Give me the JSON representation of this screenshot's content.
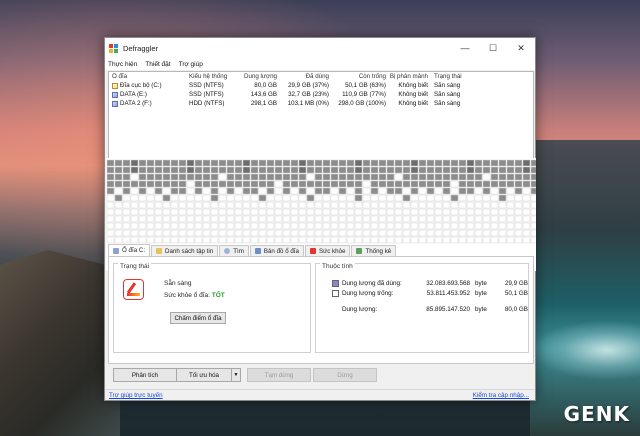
{
  "window": {
    "title": "Defraggler"
  },
  "menu": [
    "Thực hiện",
    "Thiết đặt",
    "Trợ giúp"
  ],
  "columns": [
    "Ổ đĩa",
    "Kiểu hệ thống",
    "Dung lượng",
    "Đã dùng",
    "Còn trống",
    "Bị phân mảnh",
    "Trạng thái"
  ],
  "drives": [
    {
      "name": "Đĩa cục bộ (C:)",
      "fs": "SSD (NTFS)",
      "capacity": "80,0 GB",
      "used": "29,9 GB (37%)",
      "free": "50,1 GB (63%)",
      "frag": "Không biết",
      "status": "Sẵn sàng"
    },
    {
      "name": "DATA (E:)",
      "fs": "SSD (NTFS)",
      "capacity": "143,6 GB",
      "used": "32,7 GB (23%)",
      "free": "110,9 GB (77%)",
      "frag": "Không biết",
      "status": "Sẵn sàng"
    },
    {
      "name": "DATA 2 (F:)",
      "fs": "HDD (NTFS)",
      "capacity": "298,1 GB",
      "used": "103,1 MB (0%)",
      "free": "298,0 GB (100%)",
      "frag": "Không biết",
      "status": "Sẵn sàng"
    }
  ],
  "tabs": [
    "Ổ đĩa C:",
    "Danh sách tập tin",
    "Tìm",
    "Bản đồ ổ đĩa",
    "Sức khỏe",
    "Thống kê"
  ],
  "status_panel": {
    "title": "Trạng thái",
    "ready": "Sẵn sàng",
    "health_label": "Sức khỏe ổ đĩa:",
    "health_value": "TỐT",
    "benchmark_button": "Chấm điểm ổ đĩa"
  },
  "properties": {
    "title": "Thuộc tính",
    "used_label": "Dung lượng đã dùng:",
    "used_bytes": "32.083.693.568",
    "used_unit": "byte",
    "used_size": "29,9 GB",
    "free_label": "Dung lượng trống:",
    "free_bytes": "53.811.453.952",
    "free_unit": "byte",
    "free_size": "50,1 GB",
    "total_label": "Dung lượng:",
    "total_bytes": "85.895.147.520",
    "total_unit": "byte",
    "total_size": "80,0 GB",
    "used_color": "#8a86d6",
    "free_color": "#ffffff"
  },
  "actions": {
    "analyze": "Phân tích",
    "optimize": "Tối ưu hóa",
    "pause": "Tạm dừng",
    "stop": "Dừng"
  },
  "footer": {
    "help_link": "Trợ giúp trực tuyến",
    "update_link": "Kiểm tra cập nhập..."
  },
  "watermark": "GENK",
  "colors": {
    "block_used": "#8c8c8c",
    "block_dark": "#6e6e6e",
    "block_free": "#ffffff",
    "link": "#1a4bd8",
    "health_good": "#2a9a2a"
  }
}
